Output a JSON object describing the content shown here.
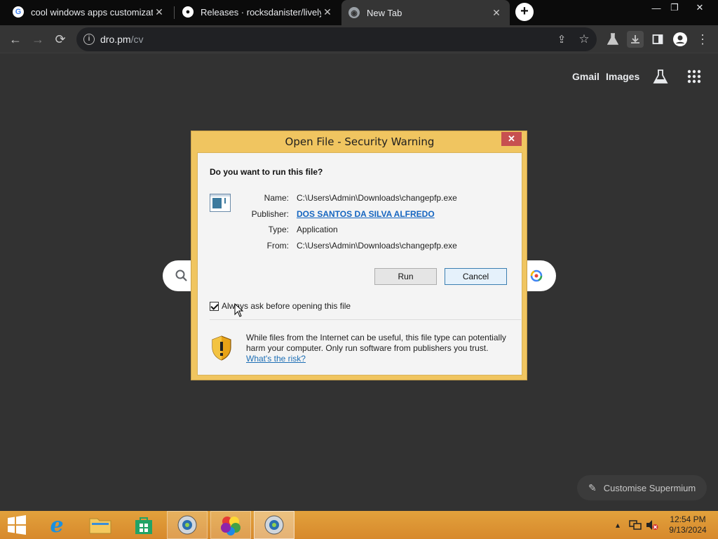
{
  "tabs": [
    {
      "title": "cool windows apps customizatio",
      "favicon": "google-g-icon"
    },
    {
      "title": "Releases · rocksdanister/lively",
      "favicon": "github-icon"
    },
    {
      "title": "New Tab",
      "favicon": "chrome-icon",
      "active": true
    }
  ],
  "toolbar": {
    "url_host": "dro.pm",
    "url_path": "/cv"
  },
  "ntp": {
    "gmail": "Gmail",
    "images": "Images",
    "customise": "Customise Supermium"
  },
  "dialog": {
    "title": "Open File - Security Warning",
    "question": "Do you want to run this file?",
    "fields": [
      {
        "label": "Name:",
        "value": "C:\\Users\\Admin\\Downloads\\changepfp.exe"
      },
      {
        "label": "Publisher:",
        "value": "DOS SANTOS DA SILVA ALFREDO"
      },
      {
        "label": "Type:",
        "value": "Application"
      },
      {
        "label": "From:",
        "value": "C:\\Users\\Admin\\Downloads\\changepfp.exe"
      }
    ],
    "run_label": "Run",
    "cancel_label": "Cancel",
    "always_ask_label": "Always ask before opening this file",
    "always_ask_checked": true,
    "warning_text": "While files from the Internet can be useful, this file type can potentially harm your computer. Only run software from publishers you trust.",
    "risk_link": "What's the risk?"
  },
  "taskbar": {
    "time": "12:54 PM",
    "date": "9/13/2024"
  },
  "colors": {
    "dialog_frame": "#f0c560",
    "link": "#1565c0",
    "taskbar": "#dd9533",
    "close_red": "#c75050"
  }
}
